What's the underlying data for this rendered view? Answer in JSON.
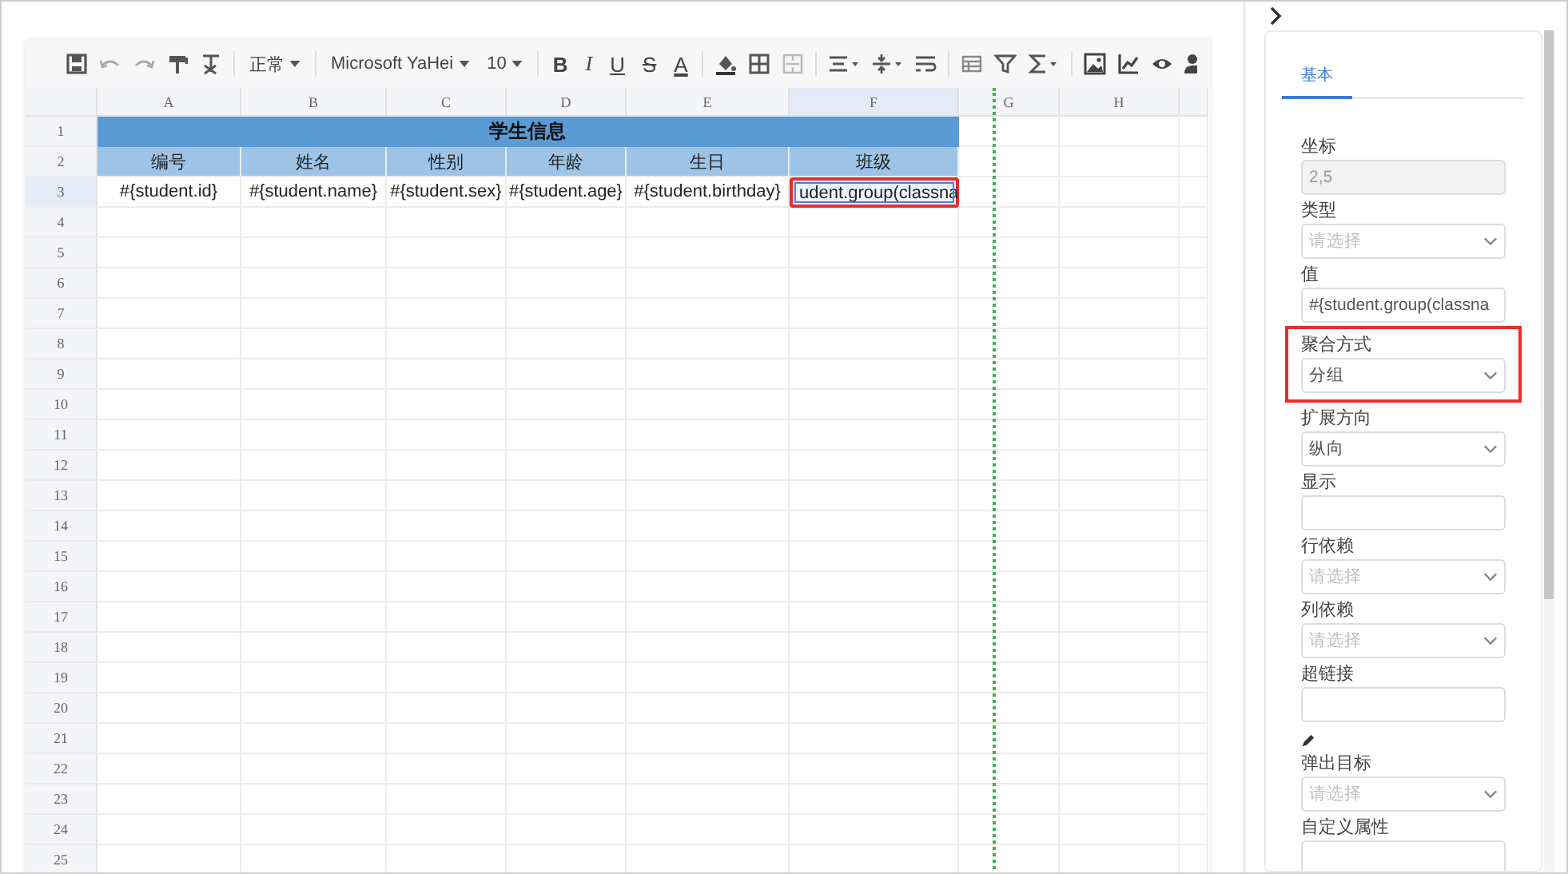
{
  "toolbar": {
    "style": "正常",
    "font": "Microsoft YaHei",
    "size": "10",
    "format_buttons": [
      {
        "label": "B",
        "kind": "bold"
      },
      {
        "label": "I",
        "kind": "italic"
      },
      {
        "label": "U",
        "kind": "underline"
      },
      {
        "label": "S",
        "kind": "strike"
      },
      {
        "label": "A",
        "kind": "color"
      }
    ]
  },
  "sheet": {
    "columns": [
      {
        "label": "A",
        "selected": false
      },
      {
        "label": "B",
        "selected": false
      },
      {
        "label": "C",
        "selected": false
      },
      {
        "label": "D",
        "selected": false
      },
      {
        "label": "E",
        "selected": false
      },
      {
        "label": "F",
        "selected": true
      },
      {
        "label": "G",
        "selected": false
      },
      {
        "label": "H",
        "selected": false
      }
    ],
    "rows": [
      {
        "label": "1",
        "selected": false
      },
      {
        "label": "2",
        "selected": false
      },
      {
        "label": "3",
        "selected": true
      },
      {
        "label": "4",
        "selected": false
      },
      {
        "label": "5",
        "selected": false
      },
      {
        "label": "6",
        "selected": false
      },
      {
        "label": "7",
        "selected": false
      },
      {
        "label": "8",
        "selected": false
      },
      {
        "label": "9",
        "selected": false
      },
      {
        "label": "10",
        "selected": false
      },
      {
        "label": "11",
        "selected": false
      },
      {
        "label": "12",
        "selected": false
      },
      {
        "label": "13",
        "selected": false
      },
      {
        "label": "14",
        "selected": false
      },
      {
        "label": "15",
        "selected": false
      },
      {
        "label": "16",
        "selected": false
      },
      {
        "label": "17",
        "selected": false
      },
      {
        "label": "18",
        "selected": false
      },
      {
        "label": "19",
        "selected": false
      },
      {
        "label": "20",
        "selected": false
      },
      {
        "label": "21",
        "selected": false
      },
      {
        "label": "22",
        "selected": false
      },
      {
        "label": "23",
        "selected": false
      },
      {
        "label": "24",
        "selected": false
      },
      {
        "label": "25",
        "selected": false
      }
    ],
    "title": "学生信息",
    "headers": [
      "编号",
      "姓名",
      "性别",
      "年龄",
      "生日",
      "班级"
    ],
    "values": [
      {
        "text": "#{student.id}",
        "selected": false,
        "highlighted": false
      },
      {
        "text": "#{student.name}",
        "selected": false,
        "highlighted": false
      },
      {
        "text": "#{student.sex}",
        "selected": false,
        "highlighted": false
      },
      {
        "text": "#{student.age}",
        "selected": false,
        "highlighted": false
      },
      {
        "text": "#{student.birthday}",
        "selected": false,
        "highlighted": false
      },
      {
        "text": "udent.group(classna",
        "selected": true,
        "highlighted": true
      }
    ]
  },
  "panel": {
    "tabs": [
      {
        "label": "基本",
        "selected": true
      }
    ],
    "fields": [
      {
        "label": "坐标",
        "kind": "input",
        "value": "2,5",
        "disabled": true
      },
      {
        "label": "类型",
        "kind": "select",
        "placeholder": "请选择"
      },
      {
        "label": "值",
        "kind": "input",
        "value": "#{student.group(classna"
      },
      {
        "label": "聚合方式",
        "kind": "select",
        "value": "分组",
        "highlighted": true
      },
      {
        "label": "扩展方向",
        "kind": "select",
        "value": "纵向"
      },
      {
        "label": "显示",
        "kind": "input"
      },
      {
        "label": "行依赖",
        "kind": "select",
        "placeholder": "请选择"
      },
      {
        "label": "列依赖",
        "kind": "select",
        "placeholder": "请选择"
      },
      {
        "label": "超链接",
        "kind": "input",
        "editable": true
      },
      {
        "label": "弹出目标",
        "kind": "select",
        "placeholder": "请选择"
      },
      {
        "label": "自定义属性",
        "kind": "input"
      }
    ]
  }
}
